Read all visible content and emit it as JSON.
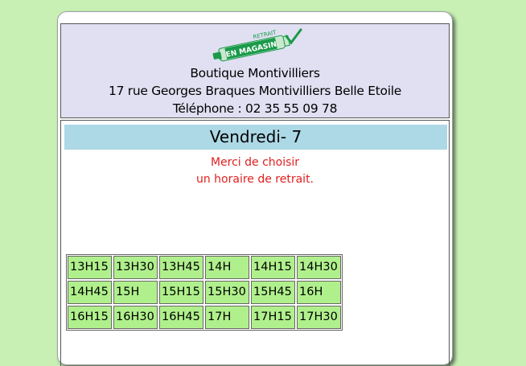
{
  "logo": {
    "text_top": "RETRAIT",
    "text_main": "EN MAGASIN",
    "icon": "retrait-en-magasin-logo",
    "colors": {
      "band": "#1a9a4a",
      "light": "#c9e8cf"
    }
  },
  "shop": {
    "name": "Boutique Montivilliers",
    "address": "17 rue Georges Braques Montivilliers Belle Etoile",
    "phone": "Téléphone : 02 35 55 09 78"
  },
  "day": {
    "label": "Vendredi- 7"
  },
  "message": {
    "line1": "Merci de choisir",
    "line2": "un horaire de retrait."
  },
  "slots": [
    "13H15",
    "13H30",
    "13H45",
    "14H",
    "14H15",
    "14H30",
    "14H45",
    "15H",
    "15H15",
    "15H30",
    "15H45",
    "16H",
    "16H15",
    "16H30",
    "16H45",
    "17H",
    "17H15",
    "17H30"
  ],
  "colors": {
    "page_bg": "#c8f0b4",
    "header_bg": "#e0e0f2",
    "day_bar": "#add8e6",
    "message": "#e02020",
    "slot_bg": "#b0f08c"
  }
}
